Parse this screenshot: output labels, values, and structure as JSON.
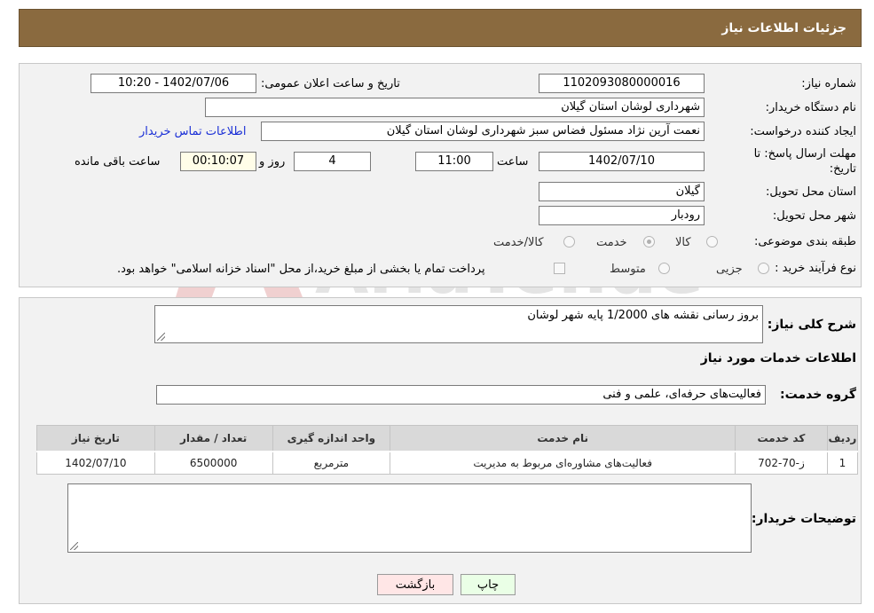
{
  "header": {
    "title": "جزئیات اطلاعات نیاز"
  },
  "form": {
    "need_number": {
      "label": "شماره نیاز:",
      "value": "1102093080000016"
    },
    "announce_datetime": {
      "label": "تاریخ و ساعت اعلان عمومی:",
      "value": "1402/07/06 - 10:20"
    },
    "buyer_org": {
      "label": "نام دستگاه خریدار:",
      "value": "شهرداری لوشان استان گیلان"
    },
    "requester": {
      "label": "ایجاد کننده درخواست:",
      "value": "نعمت آرین نژاد مسئول فضاس سبز شهرداری لوشان استان گیلان"
    },
    "buyer_contact_link": "اطلاعات تماس خریدار",
    "deadline": {
      "label_line1": "مهلت ارسال پاسخ: تا",
      "label_line2": "تاریخ:",
      "date": "1402/07/10",
      "time_label": "ساعت",
      "time": "11:00",
      "days": "4",
      "days_label": "روز و",
      "remaining": "00:10:07",
      "remaining_label": "ساعت باقی مانده"
    },
    "province": {
      "label": "استان محل تحویل:",
      "value": "گیلان"
    },
    "city": {
      "label": "شهر محل تحویل:",
      "value": "رودبار"
    },
    "category": {
      "label": "طبقه بندی موضوعی:",
      "options": [
        {
          "label": "کالا",
          "checked": false
        },
        {
          "label": "خدمت",
          "checked": true
        },
        {
          "label": "کالا/خدمت",
          "checked": false
        }
      ]
    },
    "purchase_type": {
      "label": "نوع فرآیند خرید :",
      "options": [
        {
          "label": "جزیی",
          "checked": false
        },
        {
          "label": "متوسط",
          "checked": false
        }
      ],
      "checkbox_text": "پرداخت تمام یا بخشی از مبلغ خرید،از محل \"اسناد خزانه اسلامی\" خواهد بود."
    }
  },
  "details": {
    "description_label": "شرح کلی نیاز:",
    "description": "بروز رسانی نقشه های 1/2000 پایه شهر لوشان",
    "services_title": "اطلاعات خدمات مورد نیاز",
    "service_group_label": "گروه خدمت:",
    "service_group": "فعالیت‌های حرفه‌ای، علمی و فنی",
    "table": {
      "headers": [
        "ردیف",
        "کد خدمت",
        "نام خدمت",
        "واحد اندازه گیری",
        "تعداد / مقدار",
        "تاریخ نیاز"
      ],
      "rows": [
        [
          "1",
          "ز-70-702",
          "فعالیت‌های مشاوره‌ای مربوط به مدیریت",
          "مترمربع",
          "6500000",
          "1402/07/10"
        ]
      ]
    },
    "buyer_notes_label": "توضیحات خریدار:",
    "buyer_notes": ""
  },
  "buttons": {
    "print": "چاپ",
    "back": "بازگشت"
  },
  "watermark": {
    "text": "AriaTender.net"
  }
}
